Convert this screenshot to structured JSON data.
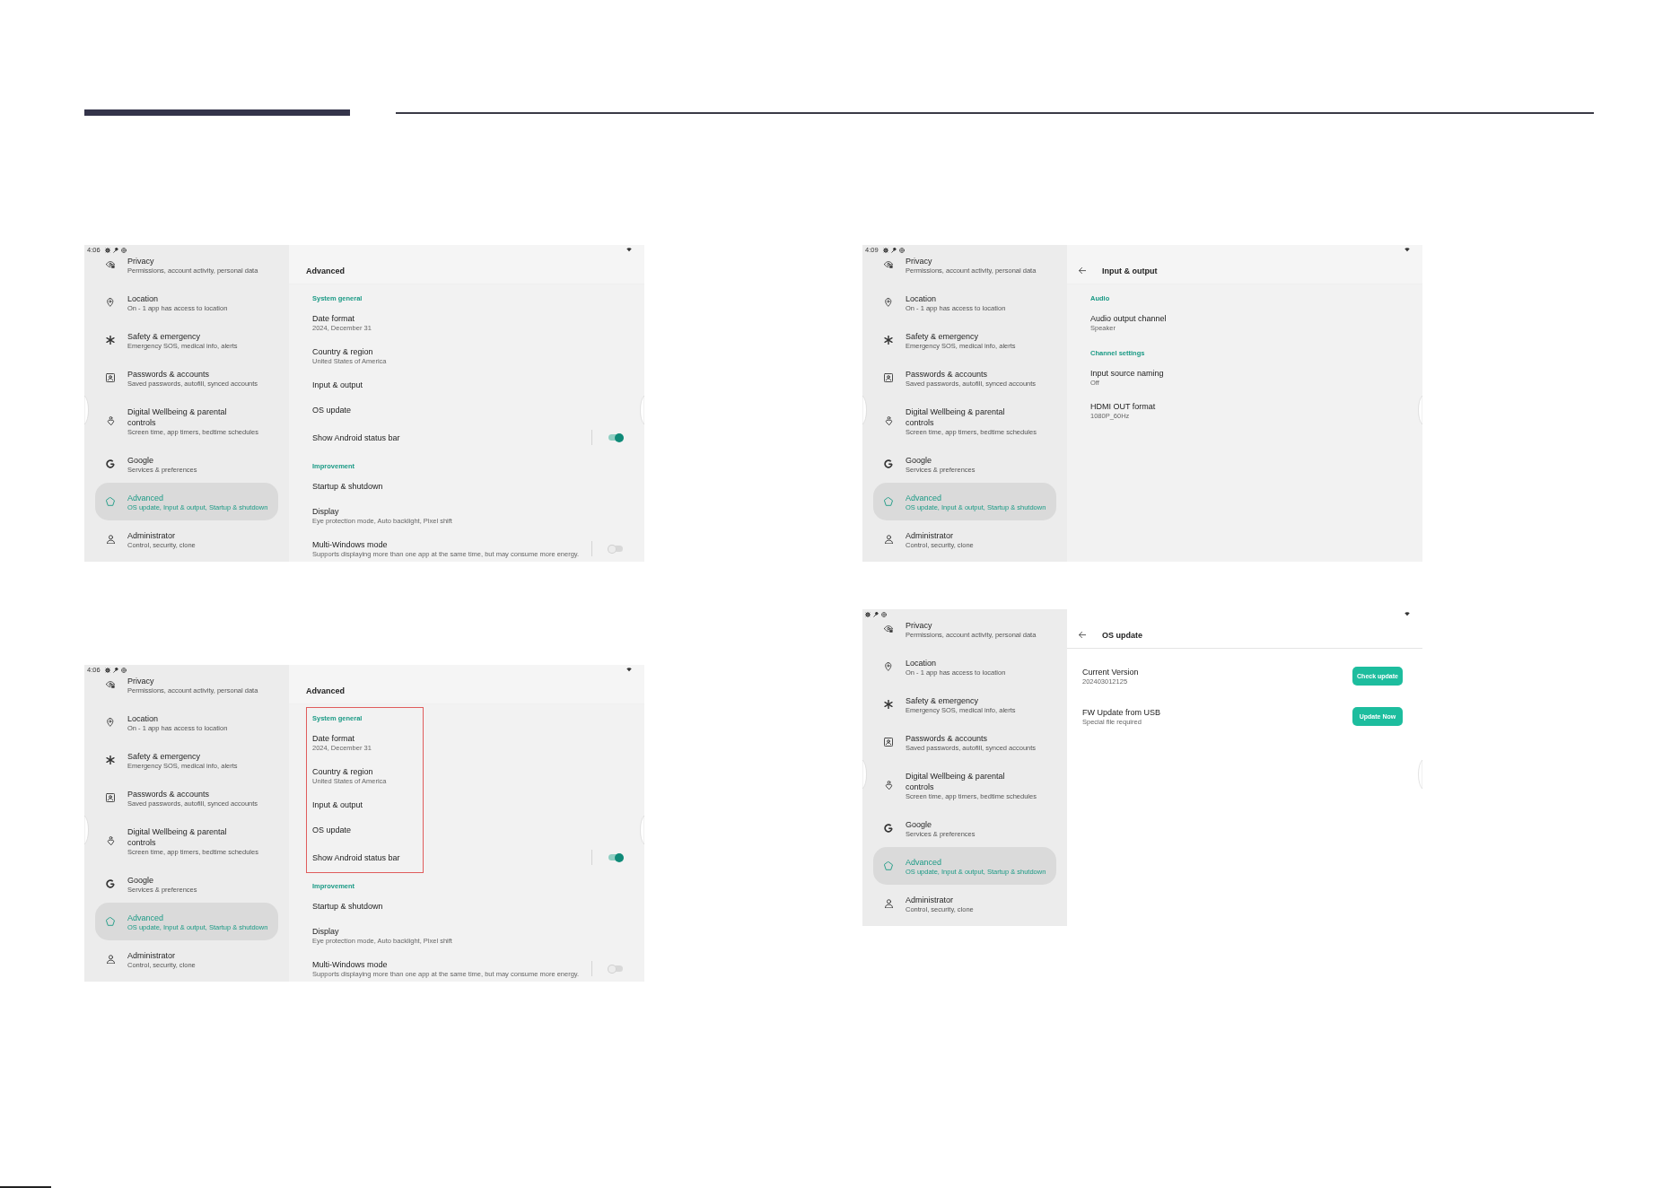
{
  "screenshots": [
    {
      "status_bar": {
        "time": "4:06"
      },
      "sidebar": {
        "items": [
          {
            "title": "Privacy",
            "subtitle": "Permissions, account activity, personal data",
            "selected": false
          },
          {
            "title": "Location",
            "subtitle": "On - 1 app has access to location",
            "selected": false
          },
          {
            "title": "Safety & emergency",
            "subtitle": "Emergency SOS, medical info, alerts",
            "selected": false
          },
          {
            "title": "Passwords & accounts",
            "subtitle": "Saved passwords, autofill, synced accounts",
            "selected": false
          },
          {
            "title": "Digital Wellbeing & parental controls",
            "subtitle": "Screen time, app timers, bedtime schedules",
            "selected": false
          },
          {
            "title": "Google",
            "subtitle": "Services & preferences",
            "selected": false
          },
          {
            "title": "Advanced",
            "subtitle": "OS update, Input & output, Startup & shutdown",
            "selected": true
          },
          {
            "title": "Administrator",
            "subtitle": "Control, security, clone",
            "selected": false
          }
        ]
      },
      "page": {
        "kind": "list",
        "title": "Advanced",
        "back": false,
        "sections": [
          {
            "label": "System general",
            "highlighted": false,
            "items": [
              {
                "kind": "text",
                "title": "Date format",
                "subtitle": "2024, December 31"
              },
              {
                "kind": "text",
                "title": "Country & region",
                "subtitle": "United States of America"
              },
              {
                "kind": "text",
                "title": "Input & output"
              },
              {
                "kind": "text",
                "title": "OS update"
              },
              {
                "kind": "toggle",
                "title": "Show Android status bar",
                "on": true
              }
            ]
          },
          {
            "label": "Improvement",
            "highlighted": false,
            "items": [
              {
                "kind": "text",
                "title": "Startup & shutdown"
              },
              {
                "kind": "text",
                "title": "Display",
                "subtitle": "Eye protection mode, Auto backlight, Pixel shift"
              },
              {
                "kind": "toggle",
                "title": "Multi-Windows mode",
                "subtitle": "Supports displaying more than one app at the same time, but may consume more energy.",
                "on": false
              }
            ]
          }
        ]
      }
    },
    {
      "status_bar": {
        "time": "4:09"
      },
      "sidebar": {
        "items": [
          {
            "title": "Privacy",
            "subtitle": "Permissions, account activity, personal data",
            "selected": false
          },
          {
            "title": "Location",
            "subtitle": "On - 1 app has access to location",
            "selected": false
          },
          {
            "title": "Safety & emergency",
            "subtitle": "Emergency SOS, medical info, alerts",
            "selected": false
          },
          {
            "title": "Passwords & accounts",
            "subtitle": "Saved passwords, autofill, synced accounts",
            "selected": false
          },
          {
            "title": "Digital Wellbeing & parental controls",
            "subtitle": "Screen time, app timers, bedtime schedules",
            "selected": false
          },
          {
            "title": "Google",
            "subtitle": "Services & preferences",
            "selected": false
          },
          {
            "title": "Advanced",
            "subtitle": "OS update, Input & output, Startup & shutdown",
            "selected": true
          },
          {
            "title": "Administrator",
            "subtitle": "Control, security, clone",
            "selected": false
          }
        ]
      },
      "page": {
        "kind": "list",
        "title": "Input & output",
        "back": true,
        "sections": [
          {
            "label": "Audio",
            "highlighted": false,
            "items": [
              {
                "kind": "text",
                "title": "Audio output channel",
                "subtitle": "Speaker"
              }
            ]
          },
          {
            "label": "Channel settings",
            "highlighted": false,
            "items": [
              {
                "kind": "text",
                "title": "Input source naming",
                "subtitle": "Off"
              },
              {
                "kind": "text",
                "title": "HDMI OUT format",
                "subtitle": "1080P_60Hz"
              }
            ]
          }
        ]
      }
    },
    {
      "status_bar": {
        "time": "4:06"
      },
      "sidebar": {
        "items": [
          {
            "title": "Privacy",
            "subtitle": "Permissions, account activity, personal data",
            "selected": false
          },
          {
            "title": "Location",
            "subtitle": "On - 1 app has access to location",
            "selected": false
          },
          {
            "title": "Safety & emergency",
            "subtitle": "Emergency SOS, medical info, alerts",
            "selected": false
          },
          {
            "title": "Passwords & accounts",
            "subtitle": "Saved passwords, autofill, synced accounts",
            "selected": false
          },
          {
            "title": "Digital Wellbeing & parental controls",
            "subtitle": "Screen time, app timers, bedtime schedules",
            "selected": false
          },
          {
            "title": "Google",
            "subtitle": "Services & preferences",
            "selected": false
          },
          {
            "title": "Advanced",
            "subtitle": "OS update, Input & output, Startup & shutdown",
            "selected": true
          },
          {
            "title": "Administrator",
            "subtitle": "Control, security, clone",
            "selected": false
          }
        ]
      },
      "page": {
        "kind": "list",
        "title": "Advanced",
        "back": false,
        "sections": [
          {
            "label": "System general",
            "highlighted": true,
            "items": [
              {
                "kind": "text",
                "title": "Date format",
                "subtitle": "2024, December 31"
              },
              {
                "kind": "text",
                "title": "Country & region",
                "subtitle": "United States of America"
              },
              {
                "kind": "text",
                "title": "Input & output"
              },
              {
                "kind": "text",
                "title": "OS update"
              },
              {
                "kind": "toggle",
                "title": "Show Android status bar",
                "on": true
              }
            ]
          },
          {
            "label": "Improvement",
            "highlighted": false,
            "items": [
              {
                "kind": "text",
                "title": "Startup & shutdown"
              },
              {
                "kind": "text",
                "title": "Display",
                "subtitle": "Eye protection mode, Auto backlight, Pixel shift"
              },
              {
                "kind": "toggle",
                "title": "Multi-Windows mode",
                "subtitle": "Supports displaying more than one app at the same time, but may consume more energy.",
                "on": false
              }
            ]
          }
        ]
      }
    },
    {
      "sidebar": {
        "items": [
          {
            "title": "Privacy",
            "subtitle": "Permissions, account activity, personal data",
            "selected": false
          },
          {
            "title": "Location",
            "subtitle": "On - 1 app has access to location",
            "selected": false
          },
          {
            "title": "Safety & emergency",
            "subtitle": "Emergency SOS, medical info, alerts",
            "selected": false
          },
          {
            "title": "Passwords & accounts",
            "subtitle": "Saved passwords, autofill, synced accounts",
            "selected": false
          },
          {
            "title": "Digital Wellbeing & parental controls",
            "subtitle": "Screen time, app timers, bedtime schedules",
            "selected": false
          },
          {
            "title": "Google",
            "subtitle": "Services & preferences",
            "selected": false
          },
          {
            "title": "Advanced",
            "subtitle": "OS update, Input & output, Startup & shutdown",
            "selected": true
          },
          {
            "title": "Administrator",
            "subtitle": "Control, security, clone",
            "selected": false
          }
        ]
      },
      "page": {
        "kind": "detail",
        "title": "OS update",
        "back": true,
        "rows": [
          {
            "title": "Current Version",
            "subtitle": "202403012125",
            "button": "Check update"
          },
          {
            "title": "FW Update from USB",
            "subtitle": "Special file required",
            "button": "Update Now"
          }
        ]
      }
    }
  ]
}
